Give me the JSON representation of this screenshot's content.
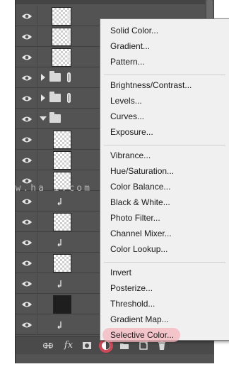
{
  "layers": [
    {
      "kind": "layer-mask-figure"
    },
    {
      "kind": "layer-mask-small"
    },
    {
      "kind": "layer-mask-figure2"
    },
    {
      "kind": "group-collapsed"
    },
    {
      "kind": "group-collapsed"
    },
    {
      "kind": "group-expanded"
    },
    {
      "kind": "plain"
    },
    {
      "kind": "plain"
    },
    {
      "kind": "plain"
    },
    {
      "kind": "clip"
    },
    {
      "kind": "plain"
    },
    {
      "kind": "clip"
    },
    {
      "kind": "plain"
    },
    {
      "kind": "clip"
    },
    {
      "kind": "dark"
    },
    {
      "kind": "clip"
    }
  ],
  "menu": {
    "groups": [
      [
        "Solid Color...",
        "Gradient...",
        "Pattern..."
      ],
      [
        "Brightness/Contrast...",
        "Levels...",
        "Curves...",
        "Exposure..."
      ],
      [
        "Vibrance...",
        "Hue/Saturation...",
        "Color Balance...",
        "Black & White...",
        "Photo Filter...",
        "Channel Mixer...",
        "Color Lookup..."
      ],
      [
        "Invert",
        "Posterize...",
        "Threshold...",
        "Gradient Map...",
        "Selective Color..."
      ]
    ],
    "highlighted": "Selective Color..."
  },
  "bottom_bar": {
    "icons": [
      "link-icon",
      "fx-icon",
      "add-mask-icon",
      "adjustment-layer-icon",
      "new-group-icon",
      "new-layer-icon",
      "trash-icon"
    ],
    "fx_label": "fx"
  },
  "watermark": "www.ha      i.com",
  "colors": {
    "panel": "#535353",
    "menu_bg": "#f0f0f0",
    "highlight": "#e34a5a"
  }
}
